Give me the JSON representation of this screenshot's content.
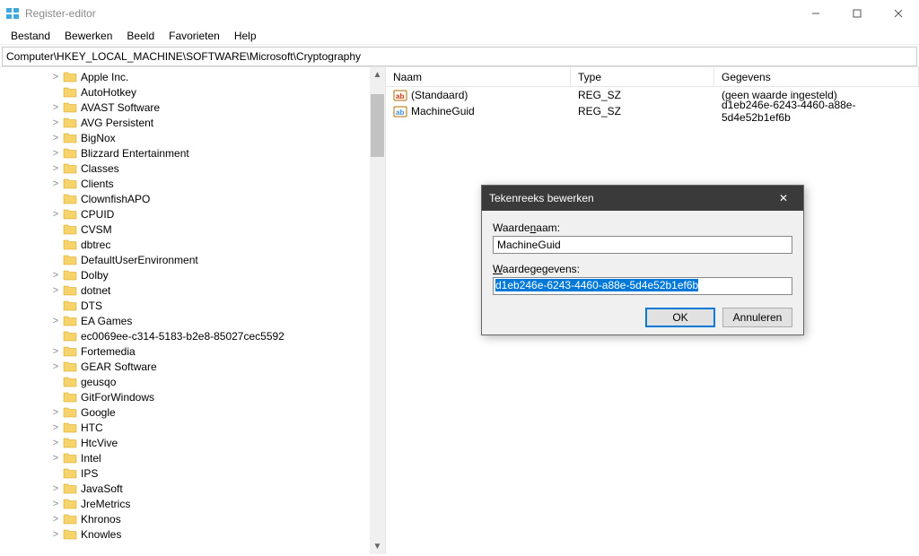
{
  "window": {
    "title": "Register-editor",
    "buttons": {
      "min": "−",
      "max": "□",
      "close": "✕"
    }
  },
  "menu": {
    "items": [
      "Bestand",
      "Bewerken",
      "Beeld",
      "Favorieten",
      "Help"
    ]
  },
  "address": "Computer\\HKEY_LOCAL_MACHINE\\SOFTWARE\\Microsoft\\Cryptography",
  "tree": {
    "items": [
      {
        "label": "Apple Inc.",
        "expandable": true
      },
      {
        "label": "AutoHotkey",
        "expandable": false
      },
      {
        "label": "AVAST Software",
        "expandable": true
      },
      {
        "label": "AVG Persistent",
        "expandable": true
      },
      {
        "label": "BigNox",
        "expandable": true
      },
      {
        "label": "Blizzard Entertainment",
        "expandable": true
      },
      {
        "label": "Classes",
        "expandable": true
      },
      {
        "label": "Clients",
        "expandable": true
      },
      {
        "label": "ClownfishAPO",
        "expandable": false
      },
      {
        "label": "CPUID",
        "expandable": true
      },
      {
        "label": "CVSM",
        "expandable": false
      },
      {
        "label": "dbtrec",
        "expandable": false
      },
      {
        "label": "DefaultUserEnvironment",
        "expandable": false
      },
      {
        "label": "Dolby",
        "expandable": true
      },
      {
        "label": "dotnet",
        "expandable": true
      },
      {
        "label": "DTS",
        "expandable": false
      },
      {
        "label": "EA Games",
        "expandable": true
      },
      {
        "label": "ec0069ee-c314-5183-b2e8-85027cec5592",
        "expandable": false
      },
      {
        "label": "Fortemedia",
        "expandable": true
      },
      {
        "label": "GEAR Software",
        "expandable": true
      },
      {
        "label": "geusqo",
        "expandable": false
      },
      {
        "label": "GitForWindows",
        "expandable": false
      },
      {
        "label": "Google",
        "expandable": true
      },
      {
        "label": "HTC",
        "expandable": true
      },
      {
        "label": "HtcVive",
        "expandable": true
      },
      {
        "label": "Intel",
        "expandable": true
      },
      {
        "label": "IPS",
        "expandable": false
      },
      {
        "label": "JavaSoft",
        "expandable": true
      },
      {
        "label": "JreMetrics",
        "expandable": true
      },
      {
        "label": "Khronos",
        "expandable": true
      },
      {
        "label": "Knowles",
        "expandable": true
      }
    ]
  },
  "values": {
    "columns": {
      "name": "Naam",
      "type": "Type",
      "data": "Gegevens"
    },
    "rows": [
      {
        "icon": "ab-red",
        "name": "(Standaard)",
        "type": "REG_SZ",
        "data": "(geen waarde ingesteld)"
      },
      {
        "icon": "ab-blue",
        "name": "MachineGuid",
        "type": "REG_SZ",
        "data": "d1eb246e-6243-4460-a88e-5d4e52b1ef6b"
      }
    ]
  },
  "dialog": {
    "title": "Tekenreeks bewerken",
    "name_label_pre": "Waarde",
    "name_label_u": "n",
    "name_label_post": "aam:",
    "name_value": "MachineGuid",
    "data_label_u": "W",
    "data_label_post": "aardegegevens:",
    "data_value": "d1eb246e-6243-4460-a88e-5d4e52b1ef6b",
    "ok": "OK",
    "cancel": "Annuleren"
  }
}
